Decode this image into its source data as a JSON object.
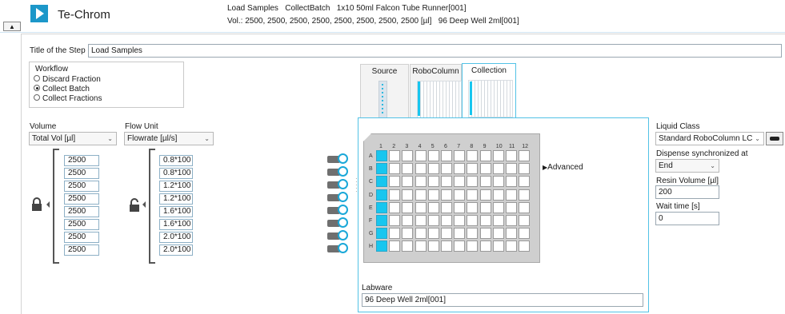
{
  "header": {
    "collapse_glyph": "▲",
    "app_title": "Te-Chrom",
    "summary_line1": "Load Samples   CollectBatch   1x10 50ml Falcon Tube Runner[001]",
    "summary_line2": "Vol.: 2500, 2500, 2500, 2500, 2500, 2500, 2500, 2500 [µl]   96 Deep Well 2ml[001]"
  },
  "step": {
    "title_label": "Title of the Step",
    "title_value": "Load Samples"
  },
  "workflow": {
    "label": "Workflow",
    "options": [
      "Discard Fraction",
      "Collect Batch",
      "Collect Fractions"
    ],
    "selected": "Collect Batch"
  },
  "volume": {
    "label": "Volume",
    "select_value": "Total Vol [µl]",
    "values": [
      "2500",
      "2500",
      "2500",
      "2500",
      "2500",
      "2500",
      "2500",
      "2500"
    ]
  },
  "flow": {
    "label": "Flow Unit",
    "select_value": "Flowrate [µl/s]",
    "values": [
      "0.8*100",
      "0.8*100",
      "1.2*100",
      "1.2*100",
      "1.6*100",
      "1.6*100",
      "2.0*100",
      "2.0*100"
    ]
  },
  "tabs": [
    {
      "label": "Source"
    },
    {
      "label": "RoboColumn"
    },
    {
      "label": "Collection"
    }
  ],
  "active_tab": "Collection",
  "plate": {
    "columns": [
      "1",
      "2",
      "3",
      "4",
      "5",
      "6",
      "7",
      "8",
      "9",
      "10",
      "11",
      "12"
    ],
    "rows": [
      "A",
      "B",
      "C",
      "D",
      "E",
      "F",
      "G",
      "H"
    ],
    "selected_column": "1"
  },
  "advanced_label": "Advanced",
  "labware": {
    "label": "Labware",
    "value": "96 Deep Well 2ml[001]"
  },
  "liquid_class": {
    "label": "Liquid Class",
    "value": "Standard RoboColumn LC"
  },
  "dispense": {
    "label": "Dispense synchronized at",
    "value": "End"
  },
  "resin": {
    "label": "Resin Volume [µl]",
    "value": "200"
  },
  "wait": {
    "label": "Wait time [s]",
    "value": "0"
  },
  "colors": {
    "accent": "#1c97c9",
    "selected_well": "#18c6ef",
    "active_border": "#52c2e6"
  }
}
